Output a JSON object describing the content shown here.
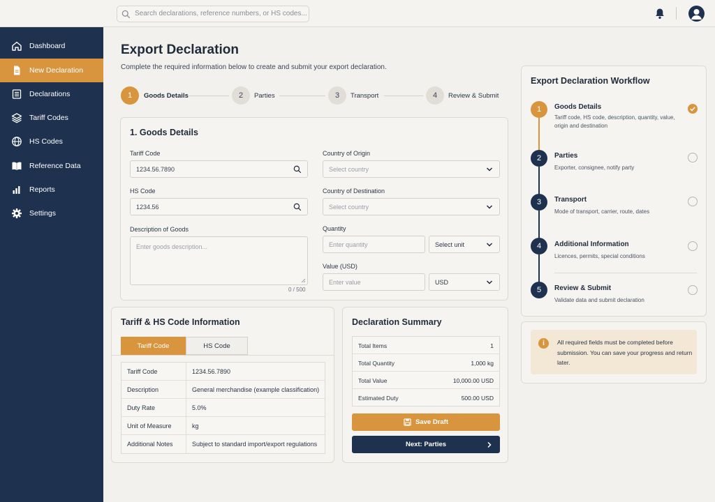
{
  "topbar": {
    "search_placeholder": "Search declarations, reference numbers, or HS codes..."
  },
  "sidebar": {
    "items": [
      {
        "label": "Dashboard",
        "icon": "home-icon"
      },
      {
        "label": "New Declaration",
        "icon": "document-icon",
        "active": true
      },
      {
        "label": "Declarations",
        "icon": "list-icon"
      },
      {
        "label": "Tariff Codes",
        "icon": "layers-icon"
      },
      {
        "label": "HS Codes",
        "icon": "globe-icon"
      },
      {
        "label": "Reference Data",
        "icon": "book-icon"
      },
      {
        "label": "Reports",
        "icon": "bar-chart-icon"
      },
      {
        "label": "Settings",
        "icon": "gear-icon"
      }
    ]
  },
  "page": {
    "title": "Export Declaration",
    "subtitle": "Complete the required information below to create and submit your export declaration."
  },
  "stepper": {
    "steps": [
      {
        "num": "1",
        "label": "Goods Details",
        "active": true
      },
      {
        "num": "2",
        "label": "Parties"
      },
      {
        "num": "3",
        "label": "Transport"
      },
      {
        "num": "4",
        "label": "Review & Submit"
      }
    ]
  },
  "goods": {
    "title": "1. Goods Details",
    "tariff_label": "Tariff Code",
    "tariff_value": "1234.56.7890",
    "hs_label": "HS Code",
    "hs_value": "1234.56",
    "desc_label": "Description of Goods",
    "desc_placeholder": "Enter goods description...",
    "desc_counter": "0 / 500",
    "origin_label": "Country of Origin",
    "origin_placeholder": "Select country",
    "dest_label": "Country of Destination",
    "dest_placeholder": "Select country",
    "qty_label": "Quantity",
    "qty_placeholder": "Enter quantity",
    "unit_placeholder": "Select unit",
    "value_label": "Value (USD)",
    "value_placeholder": "Enter value",
    "currency": "USD"
  },
  "tariff_info": {
    "title": "Tariff & HS Code Information",
    "tabs": [
      "Tariff Code",
      "HS Code"
    ],
    "rows": [
      {
        "k": "Tariff Code",
        "v": "1234.56.7890"
      },
      {
        "k": "Description",
        "v": "General merchandise (example classification)"
      },
      {
        "k": "Duty Rate",
        "v": "5.0%"
      },
      {
        "k": "Unit of Measure",
        "v": "kg"
      },
      {
        "k": "Additional Notes",
        "v": "Subject to standard import/export regulations"
      }
    ]
  },
  "summary": {
    "title": "Declaration Summary",
    "rows": [
      {
        "k": "Total Items",
        "v": "1"
      },
      {
        "k": "Total Quantity",
        "v": "1,000 kg"
      },
      {
        "k": "Total Value",
        "v": "10,000.00 USD"
      },
      {
        "k": "Estimated Duty",
        "v": "500.00 USD"
      }
    ],
    "save_label": "Save Draft",
    "next_label": "Next: Parties"
  },
  "workflow": {
    "title": "Export Declaration Workflow",
    "steps": [
      {
        "num": "1",
        "title": "Goods Details",
        "desc": "Tariff code, HS code, description, quantity, value, origin and destination",
        "status": "done"
      },
      {
        "num": "2",
        "title": "Parties",
        "desc": "Exporter, consignee, notify party",
        "status": "pending"
      },
      {
        "num": "3",
        "title": "Transport",
        "desc": "Mode of transport, carrier, route, dates",
        "status": "pending"
      },
      {
        "num": "4",
        "title": "Additional Information",
        "desc": "Licences, permits, special conditions",
        "status": "pending"
      },
      {
        "num": "5",
        "title": "Review & Submit",
        "desc": "Validate data and submit declaration",
        "status": "pending"
      }
    ]
  },
  "notice": {
    "text": "All required fields must be completed before submission. You can save your progress and return later."
  },
  "colors": {
    "navy": "#1e3250",
    "accent": "#d9953d",
    "background": "#f3f1ed"
  }
}
